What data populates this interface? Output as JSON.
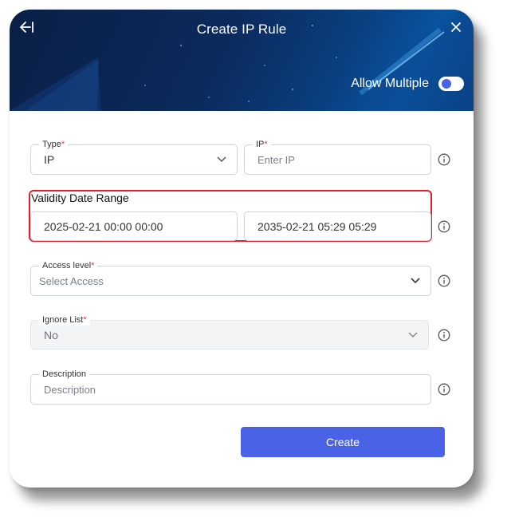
{
  "header": {
    "title": "Create IP Rule",
    "allow_multiple_label": "Allow Multiple",
    "allow_multiple_on": false,
    "back_icon": "back-arrow-icon",
    "close_icon": "close-icon"
  },
  "form": {
    "type": {
      "label": "Type",
      "required": "*",
      "value": "IP"
    },
    "ip": {
      "label": "IP",
      "required": "*",
      "placeholder": "Enter IP"
    },
    "validity": {
      "label": "Validity Date Range",
      "start": "2025-02-21 00:00 00:00",
      "end": "2035-02-21 05:29 05:29"
    },
    "access_level": {
      "label": "Access level",
      "required": "*",
      "placeholder": "Select Access"
    },
    "ignore_list": {
      "label": "Ignore List",
      "required": "*",
      "value": "No",
      "disabled": true
    },
    "description": {
      "label": "Description",
      "placeholder": "Description"
    }
  },
  "actions": {
    "create_label": "Create"
  },
  "colors": {
    "primary": "#4a62e6",
    "required": "#e0354a",
    "highlight": "#e41f2d",
    "header_dark": "#0a1f46"
  }
}
